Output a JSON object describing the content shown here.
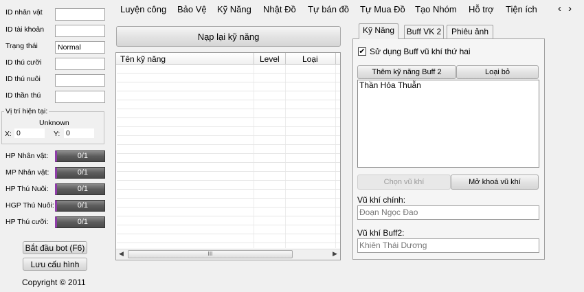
{
  "fields": [
    {
      "label": "ID nhân vật",
      "value": ""
    },
    {
      "label": "ID tài khoản",
      "value": ""
    },
    {
      "label": "Trạng thái",
      "value": "Normal"
    },
    {
      "label": "ID thú cưỡi",
      "value": ""
    },
    {
      "label": "ID thú nuôi",
      "value": ""
    },
    {
      "label": "ID thần thú",
      "value": ""
    }
  ],
  "position": {
    "legend": "Vị trí hiện tại:",
    "name": "Unknown",
    "x_label": "X:",
    "x_value": "0",
    "y_label": "Y:",
    "y_value": "0"
  },
  "bars": [
    {
      "label": "HP Nhân vật:",
      "value": "0/1"
    },
    {
      "label": "MP Nhân vật:",
      "value": "0/1"
    },
    {
      "label": "HP Thú Nuôi:",
      "value": "0/1"
    },
    {
      "label": "HGP Thú Nuôi:",
      "value": "0/1"
    },
    {
      "label": "HP Thú cưỡi:",
      "value": "0/1"
    }
  ],
  "buttons": {
    "start_bot": "Bắt đầu bot (F6)",
    "save_config": "Lưu cấu hình"
  },
  "copyright": "Copyright © 2011",
  "menu": [
    "Luyện công",
    "Bảo Vệ",
    "Kỹ Năng",
    "Nhật Đồ",
    "Tự bán đồ",
    "Tự Mua Đồ",
    "Tạo Nhóm",
    "Hỗ trợ",
    "Tiện ích"
  ],
  "scroll_arrows": {
    "left": "‹",
    "right": "›"
  },
  "reload_skills": "Nạp lại kỹ năng",
  "skill_table": {
    "columns": [
      "Tên kỹ năng",
      "Level",
      "Loại"
    ],
    "rows": [],
    "hscroll_grip": "III"
  },
  "tabs": [
    "Kỹ Năng",
    "Buff VK 2",
    "Phiêu ảnh"
  ],
  "buff_panel": {
    "use_second_weapon_label": "Sử dụng Buff vũ khí thứ hai",
    "use_second_weapon_checked": true,
    "add_skill_button": "Thêm kỹ năng Buff 2",
    "remove_button": "Loại bỏ",
    "skill_list": [
      "Thần Hỏa Thuẫn"
    ],
    "select_weapon_button": "Chọn vũ khí",
    "unlock_weapon_button": "Mở khoá vũ khí",
    "main_weapon_label": "Vũ khí chính:",
    "main_weapon_value": "Đoạn Ngọc Đao",
    "buff_weapon_label": "Vũ khí Buff2:",
    "buff_weapon_value": "Khiên Thái Dương"
  }
}
